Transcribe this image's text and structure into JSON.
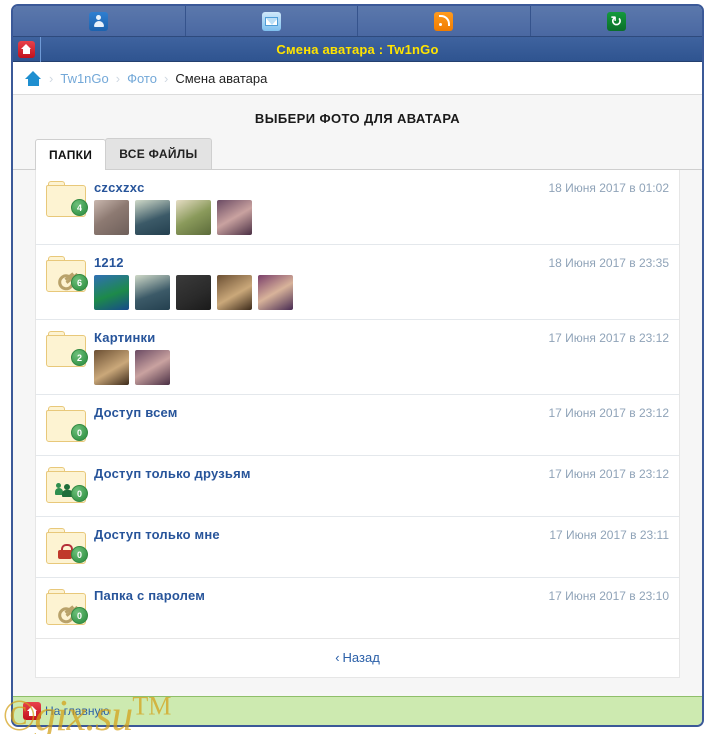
{
  "topbar": {
    "items": [
      {
        "icon": "user-icon",
        "name": "profile"
      },
      {
        "icon": "mail-icon",
        "name": "messages"
      },
      {
        "icon": "rss-icon",
        "name": "feed"
      },
      {
        "icon": "refresh-icon",
        "name": "refresh"
      }
    ]
  },
  "titlebar": {
    "home_icon": "home-icon",
    "title": "Смена аватара : Tw1nGo"
  },
  "breadcrumb": {
    "home_icon": "home-icon",
    "separator": "›",
    "items": [
      {
        "label": "Tw1nGo",
        "current": false
      },
      {
        "label": "Фото",
        "current": false
      },
      {
        "label": "Смена аватара",
        "current": true
      }
    ]
  },
  "main": {
    "heading": "ВЫБЕРИ ФОТО ДЛЯ АВАТАРА",
    "tabs": [
      {
        "label": "ПАПКИ",
        "active": true
      },
      {
        "label": "ВСЕ ФАЙЛЫ",
        "active": false
      }
    ],
    "folders": [
      {
        "name": "czcxzxc",
        "count": "4",
        "overlay": "none",
        "date": "18 Июня 2017 в 01:02",
        "thumbs": [
          "linear-gradient(145deg,#c9b7ae,#8d7a72 45%,#6e5f5a)",
          "linear-gradient(160deg,#cfd9c8,#3c5a68 55%,#24404f)",
          "linear-gradient(150deg,#e6ddc4,#8a9a5b 50%,#5c6b3a)",
          "linear-gradient(150deg,#6a4a63,#c9a2a0 50%,#4a2f44)"
        ]
      },
      {
        "name": "1212",
        "count": "6",
        "overlay": "key",
        "date": "18 Июня 2017 в 23:35",
        "thumbs": [
          "linear-gradient(160deg,#2f6fb5,#1d8a4a 55%,#174a8c)",
          "linear-gradient(160deg,#cfd9c8,#3c5a68 55%,#24404f)",
          "linear-gradient(150deg,#3a3a3a,#2a2a2a 60%,#1a1a1a)",
          "linear-gradient(150deg,#6b4f33,#caa87a 55%,#3c2a1a)",
          "linear-gradient(150deg,#7a3f6a,#d8b39a 50%,#472a52)"
        ]
      },
      {
        "name": "Картинки",
        "count": "2",
        "overlay": "none",
        "date": "17 Июня 2017 в 23:12",
        "thumbs": [
          "linear-gradient(150deg,#6b4f33,#caa87a 55%,#3c2a1a)",
          "linear-gradient(150deg,#6a4a63,#c9a2a0 50%,#4a2f44)"
        ]
      },
      {
        "name": "Доступ всем",
        "count": "0",
        "overlay": "none",
        "date": "17 Июня 2017 в 23:12",
        "thumbs": []
      },
      {
        "name": "Доступ только друзьям",
        "count": "0",
        "overlay": "friends",
        "date": "17 Июня 2017 в 23:12",
        "thumbs": []
      },
      {
        "name": "Доступ только мне",
        "count": "0",
        "overlay": "lock",
        "date": "17 Июня 2017 в 23:11",
        "thumbs": []
      },
      {
        "name": "Папка с паролем",
        "count": "0",
        "overlay": "key",
        "date": "17 Июня 2017 в 23:10",
        "thumbs": []
      }
    ],
    "back": {
      "chevron": "‹",
      "label": "Назад"
    }
  },
  "footer": {
    "home_icon": "home-icon",
    "label": "На главную"
  },
  "watermark": {
    "text": "©gix.su",
    "tm": "TM"
  },
  "colors": {
    "frame_border": "#3b5998",
    "titlebar_bg": "#2f5490",
    "title_text": "#ffe400",
    "folder_name": "#27549a",
    "date_text": "#8fa3b8",
    "badge_green": "#3c9a4e",
    "footer_bg": "#cdeab0",
    "watermark": "#d4a017"
  }
}
